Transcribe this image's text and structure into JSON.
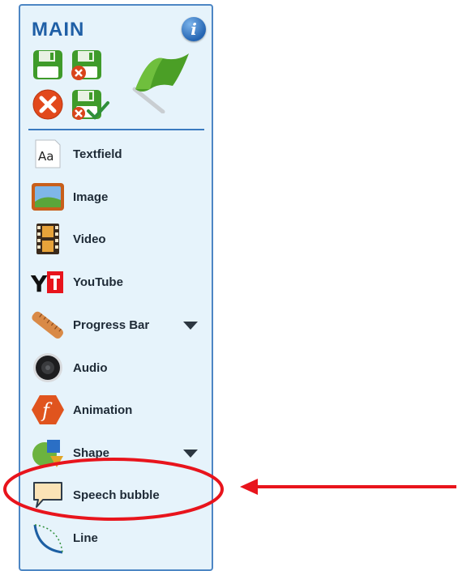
{
  "panel": {
    "title": "MAIN",
    "info_glyph": "i",
    "toolbar": [
      {
        "name": "save-button",
        "icon": "floppy-disk-icon"
      },
      {
        "name": "save-discard-button",
        "icon": "floppy-disk-x-icon"
      },
      {
        "name": "cancel-button",
        "icon": "red-x-circle-icon"
      },
      {
        "name": "save-confirm-button",
        "icon": "floppy-disk-check-icon"
      },
      {
        "name": "flag-button",
        "icon": "green-flag-icon"
      }
    ],
    "items": [
      {
        "label": "Textfield",
        "icon": "textfield-icon",
        "has_dropdown": false
      },
      {
        "label": "Image",
        "icon": "image-icon",
        "has_dropdown": false
      },
      {
        "label": "Video",
        "icon": "film-strip-icon",
        "has_dropdown": false
      },
      {
        "label": "YouTube",
        "icon": "youtube-icon",
        "has_dropdown": false,
        "icon_text": "Y"
      },
      {
        "label": "Progress Bar",
        "icon": "ruler-icon",
        "has_dropdown": true
      },
      {
        "label": "Audio",
        "icon": "speaker-icon",
        "has_dropdown": false
      },
      {
        "label": "Animation",
        "icon": "animation-f-icon",
        "has_dropdown": false,
        "icon_text": "f"
      },
      {
        "label": "Shape",
        "icon": "shapes-icon",
        "has_dropdown": true
      },
      {
        "label": "Speech bubble",
        "icon": "speech-bubble-icon",
        "has_dropdown": false,
        "highlighted": true
      },
      {
        "label": "Line",
        "icon": "curved-line-icon",
        "has_dropdown": false
      }
    ]
  },
  "colors": {
    "panel_bg": "#e6f3fb",
    "panel_border": "#4d86c4",
    "title": "#1f5fa6",
    "annotation": "#e8141c"
  }
}
